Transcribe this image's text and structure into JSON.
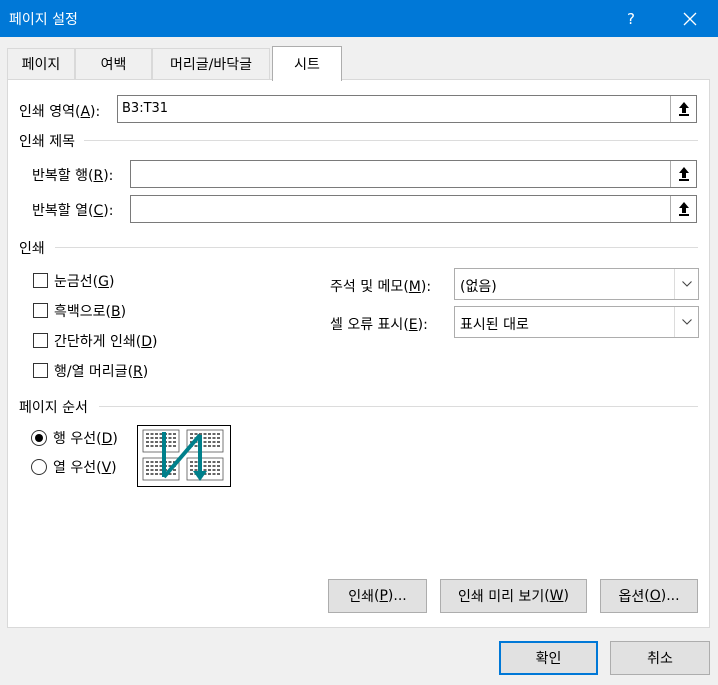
{
  "window": {
    "title": "페이지 설정",
    "help_label": "?"
  },
  "tabs": [
    {
      "label": "페이지"
    },
    {
      "label": "여백"
    },
    {
      "label": "머리글/바닥글"
    },
    {
      "label": "시트"
    }
  ],
  "print_area": {
    "label": "인쇄 영역",
    "key": "A",
    "value": "B3:T31"
  },
  "print_titles": {
    "group": "인쇄 제목",
    "rows_label": "반복할 행",
    "rows_key": "R",
    "rows_value": "",
    "cols_label": "반복할 열",
    "cols_key": "C",
    "cols_value": ""
  },
  "print": {
    "group": "인쇄",
    "gridlines": {
      "label": "눈금선",
      "key": "G",
      "checked": false
    },
    "black_white": {
      "label": "흑백으로",
      "key": "B",
      "checked": false
    },
    "draft": {
      "label": "간단하게 인쇄",
      "key": "D",
      "checked": false
    },
    "headings": {
      "label": "행/열 머리글",
      "key": "R",
      "checked": false
    },
    "comments": {
      "label": "주석 및 메모",
      "key": "M",
      "value": "(없음)"
    },
    "errors": {
      "label": "셀 오류 표시",
      "key": "E",
      "value": "표시된 대로"
    }
  },
  "page_order": {
    "group": "페이지 순서",
    "down_then_over": {
      "label": "행 우선",
      "key": "D",
      "selected": true
    },
    "over_then_down": {
      "label": "열 우선",
      "key": "V",
      "selected": false
    }
  },
  "panel_buttons": {
    "print": {
      "label": "인쇄",
      "key": "P",
      "suffix": "..."
    },
    "preview": {
      "label": "인쇄 미리 보기",
      "key": "W",
      "suffix": ""
    },
    "options": {
      "label": "옵션",
      "key": "O",
      "suffix": "..."
    }
  },
  "footer": {
    "ok": "확인",
    "cancel": "취소"
  },
  "colors": {
    "titlebar": "#0078d7",
    "panel": "#ffffff",
    "dialog": "#f0f0f0",
    "preview_arrow": "#00808b"
  }
}
